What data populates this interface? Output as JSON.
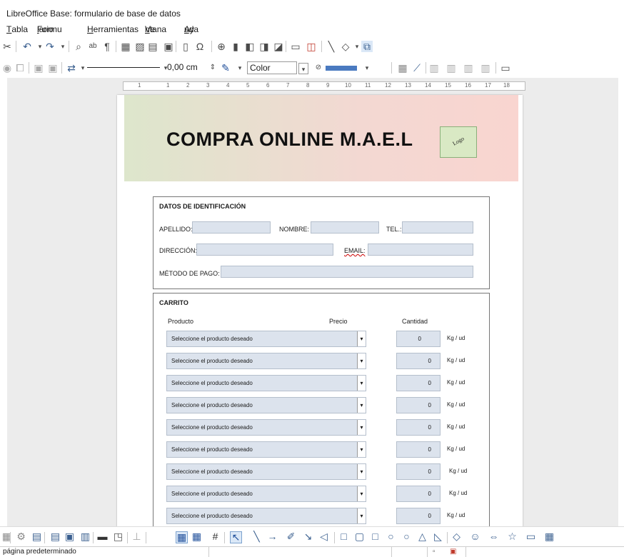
{
  "window": {
    "title": "LibreOffice Base: formulario de base de datos"
  },
  "menu": [
    {
      "pre": "",
      "u": "T",
      "post": "abla"
    },
    {
      "pre": "Formu",
      "u": "l",
      "post": "ario"
    },
    {
      "pre": "",
      "u": "H",
      "post": "erramientas"
    },
    {
      "pre": "Ve",
      "u": "n",
      "post": "tana"
    },
    {
      "pre": "Ay",
      "u": "u",
      "post": "da"
    }
  ],
  "toolbar2": {
    "line_width": "0,00 cm",
    "area_style": "Color"
  },
  "ruler": [
    "1",
    "1",
    "2",
    "3",
    "4",
    "5",
    "6",
    "7",
    "8",
    "9",
    "10",
    "11",
    "12",
    "13",
    "14",
    "15",
    "16",
    "17",
    "18"
  ],
  "banner": {
    "title": "COMPRA ONLINE M.A.E.L",
    "logo": "Logo"
  },
  "identification": {
    "title": "DATOS DE IDENTIFICACIÓN",
    "apellido": "APELLIDO:",
    "nombre": "NOMBRE:",
    "tel": "TEL.:",
    "direccion": "DIRECCIÓN:",
    "email": "EMAIL:",
    "metodo_pago": "MÉTODO DE PAGO:"
  },
  "cart": {
    "title": "CARRITO",
    "col_producto": "Producto",
    "col_precio": "Precio",
    "col_cantidad": "Cantidad",
    "rows": [
      {
        "product": "Seleccione el producto deseado",
        "qty": "0",
        "unit": "Kg / ud"
      },
      {
        "product": "Seleccione el producto deseado",
        "qty": "0",
        "unit": "Kg / ud"
      },
      {
        "product": "Seleccione el producto deseado",
        "qty": "0",
        "unit": "Kg / ud"
      },
      {
        "product": "Seleccione el producto deseado",
        "qty": "0",
        "unit": "Kg / ud"
      },
      {
        "product": "Seleccione el producto deseado",
        "qty": "0",
        "unit": "Kg / ud"
      },
      {
        "product": "Seleccione el producto deseado",
        "qty": "0",
        "unit": "Kg / ud"
      },
      {
        "product": "Seleccione el producto deseado",
        "qty": "0",
        "unit": "Kg / ud"
      },
      {
        "product": "Seleccione el producto deseado",
        "qty": "0",
        "unit": "Kg / ud"
      },
      {
        "product": "Seleccione el producto deseado",
        "qty": "0",
        "unit": "Kg / ud"
      }
    ]
  },
  "status": {
    "page_style": "página predeterminado"
  }
}
